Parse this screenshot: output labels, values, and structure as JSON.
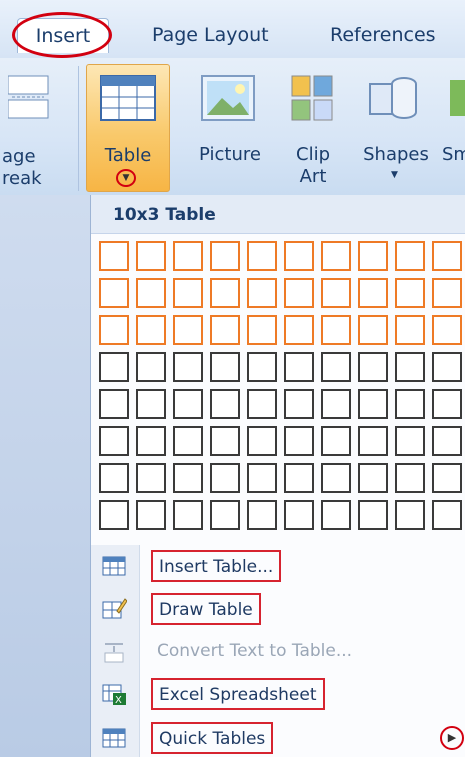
{
  "tabs": {
    "insert": "Insert",
    "page_layout": "Page Layout",
    "references": "References"
  },
  "ribbon": {
    "page_break_line1": "age",
    "page_break_line2": "reak",
    "table": "Table",
    "picture": "Picture",
    "clip_line1": "Clip",
    "clip_line2": "Art",
    "shapes": "Shapes",
    "smart_partial": "Sm"
  },
  "table_menu": {
    "title": "10x3 Table",
    "grid_columns": 10,
    "grid_rows": 8,
    "selected_columns": 10,
    "selected_rows": 3,
    "items": [
      {
        "label": "Insert Table...",
        "icon": "insert-table-icon",
        "enabled": true
      },
      {
        "label": "Draw Table",
        "icon": "draw-table-icon",
        "enabled": true
      },
      {
        "label": "Convert Text to Table...",
        "icon": "convert-text-icon",
        "enabled": false
      },
      {
        "label": "Excel Spreadsheet",
        "icon": "excel-icon",
        "enabled": true
      },
      {
        "label": "Quick Tables",
        "icon": "quick-tables-icon",
        "enabled": true
      }
    ]
  },
  "colors": {
    "highlight": "#ee7a26",
    "annotation": "#d20010"
  }
}
